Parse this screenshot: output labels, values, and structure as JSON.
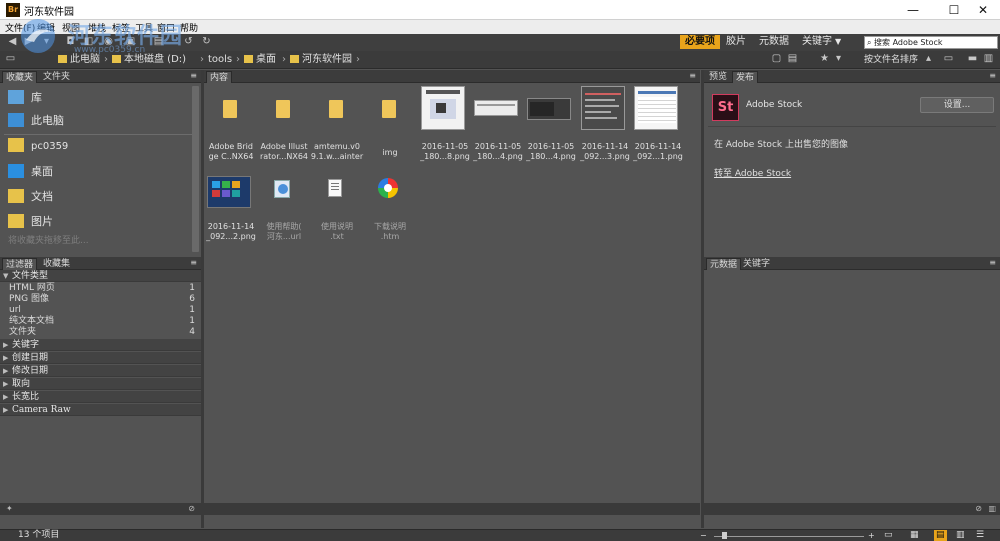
{
  "window": {
    "app_icon": "Br",
    "title": "河东软件园",
    "minimize_label": "—",
    "maximize_label": "☐",
    "close_label": "✕"
  },
  "menu": [
    "文件(F)",
    "编辑",
    "视图",
    "堆栈",
    "标签",
    "工具",
    "窗口",
    "帮助"
  ],
  "workspaces": {
    "active": "必要项",
    "film": "胶片",
    "metadata": "元数据",
    "keywords": "关键字",
    "dropdown": "▼"
  },
  "search": {
    "placeholder": "搜索 Adobe Stock",
    "icon": "search-icon"
  },
  "breadcrumb": {
    "items": [
      "此电脑",
      "本地磁盘 (D:)",
      "tools",
      "桌面",
      "河东软件园"
    ]
  },
  "sort_label": "按文件名排序",
  "favorites_panel": {
    "tabs": [
      "收藏夹",
      "文件夹"
    ],
    "items": [
      {
        "label": "库",
        "icon": "library-icon"
      },
      {
        "label": "此电脑",
        "icon": "computer-icon"
      },
      {
        "label": "pc0359",
        "icon": "folder-icon"
      },
      {
        "label": "桌面",
        "icon": "desktop-icon"
      },
      {
        "label": "文档",
        "icon": "documents-icon"
      },
      {
        "label": "图片",
        "icon": "pictures-icon"
      }
    ],
    "drop_hint": "将收藏夹拖移至此..."
  },
  "filter_panel": {
    "tabs": [
      "过滤器",
      "收藏集"
    ],
    "file_type_header": "文件类型",
    "file_types": [
      {
        "name": "HTML 网页",
        "count": "1"
      },
      {
        "name": "PNG 图像",
        "count": "6"
      },
      {
        "name": "url",
        "count": "1"
      },
      {
        "name": "纯文本文档",
        "count": "1"
      },
      {
        "name": "文件夹",
        "count": "4"
      }
    ],
    "sections": [
      "关键字",
      "创建日期",
      "修改日期",
      "取向",
      "长宽比",
      "Camera Raw"
    ]
  },
  "content_panel": {
    "tab": "内容",
    "items": [
      {
        "label": "Adobe Brid\nge C..NX64",
        "kind": "folder"
      },
      {
        "label": "Adobe Illust\nrator...NX64",
        "kind": "folder"
      },
      {
        "label": "amtemu.v0\n9.1.w...ainter",
        "kind": "folder"
      },
      {
        "label": "img",
        "kind": "folder"
      },
      {
        "label": "2016-11-05\n_180...8.png",
        "kind": "screenshot-light"
      },
      {
        "label": "2016-11-05\n_180...4.png",
        "kind": "screenshot-wide"
      },
      {
        "label": "2016-11-05\n_180...4.png",
        "kind": "screenshot-dark"
      },
      {
        "label": "2016-11-14\n_092...3.png",
        "kind": "screenshot-code"
      },
      {
        "label": "2016-11-14\n_092...1.png",
        "kind": "screenshot-table"
      },
      {
        "label": "2016-11-14\n_092...2.png",
        "kind": "screenshot-tiles"
      },
      {
        "label": "使用帮助(\n河东...url",
        "kind": "url"
      },
      {
        "label": "使用说明\n.txt",
        "kind": "text"
      },
      {
        "label": "下载说明\n.htm",
        "kind": "html"
      }
    ]
  },
  "preview_panel": {
    "tabs": [
      "预览",
      "发布"
    ],
    "stock_logo": "St",
    "stock_name": "Adobe Stock",
    "settings_button": "设置...",
    "description": "在 Adobe Stock 上出售您的图像",
    "link": "转至 Adobe Stock"
  },
  "metadata_panel": {
    "tabs": [
      "元数据",
      "关键字"
    ]
  },
  "status": {
    "item_count": "13 个项目"
  },
  "watermark": {
    "text": "河东软件园",
    "url": "www.pc0359.cn"
  },
  "colors": {
    "accent": "#e9a41b",
    "panel_bg": "#535353",
    "stock_brand": "#d23b5e"
  }
}
